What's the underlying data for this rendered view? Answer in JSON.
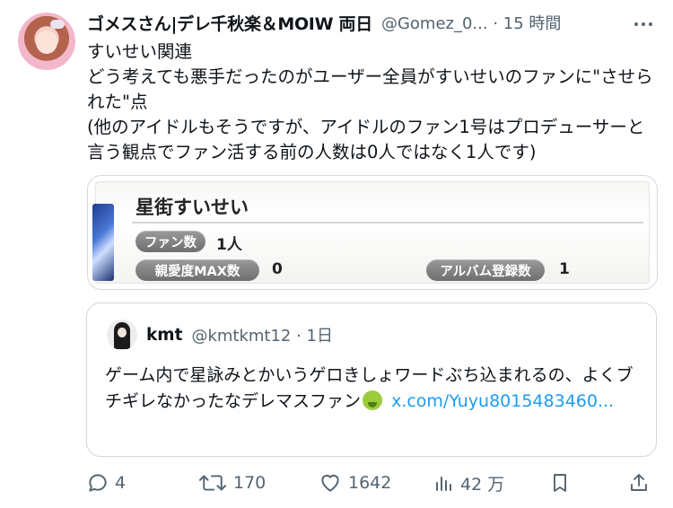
{
  "post": {
    "display_name": "ゴメスさん|デレ千秋楽＆MOIW 両日",
    "handle": "@Gomez_0...",
    "time": "· 15 時間",
    "text": "すいせい関連\nどう考えても悪手だったのがユーザー全員がすいせいのファンに\"させられた\"点\n(他のアイドルもそうですが、アイドルのファン1号はプロデューサーと言う観点でファン活する前の人数は0人ではなく1人です)"
  },
  "media": {
    "idol_name": "星街すいせい",
    "fan_label": "ファン数",
    "fan_value": "1人",
    "affection_label": "親愛度MAX数",
    "affection_value": "0",
    "album_label": "アルバム登録数",
    "album_value": "1"
  },
  "quote": {
    "display_name": "kmt",
    "handle": "@kmtkmt12 · 1日",
    "text": "ゲーム内で星詠みとかいうゲロきしょワードぶち込まれるの、よくブチギレなかったなデレマスファン",
    "emoji": "nauseated-face",
    "link": "x.com/Yuyu8015483460..."
  },
  "actions": {
    "replies": "4",
    "reposts": "170",
    "likes": "1642",
    "views": "42 万"
  },
  "colors": {
    "text": "#0f1419",
    "secondary": "#536471",
    "link": "#1d9bf0",
    "border": "#cfd9de"
  }
}
